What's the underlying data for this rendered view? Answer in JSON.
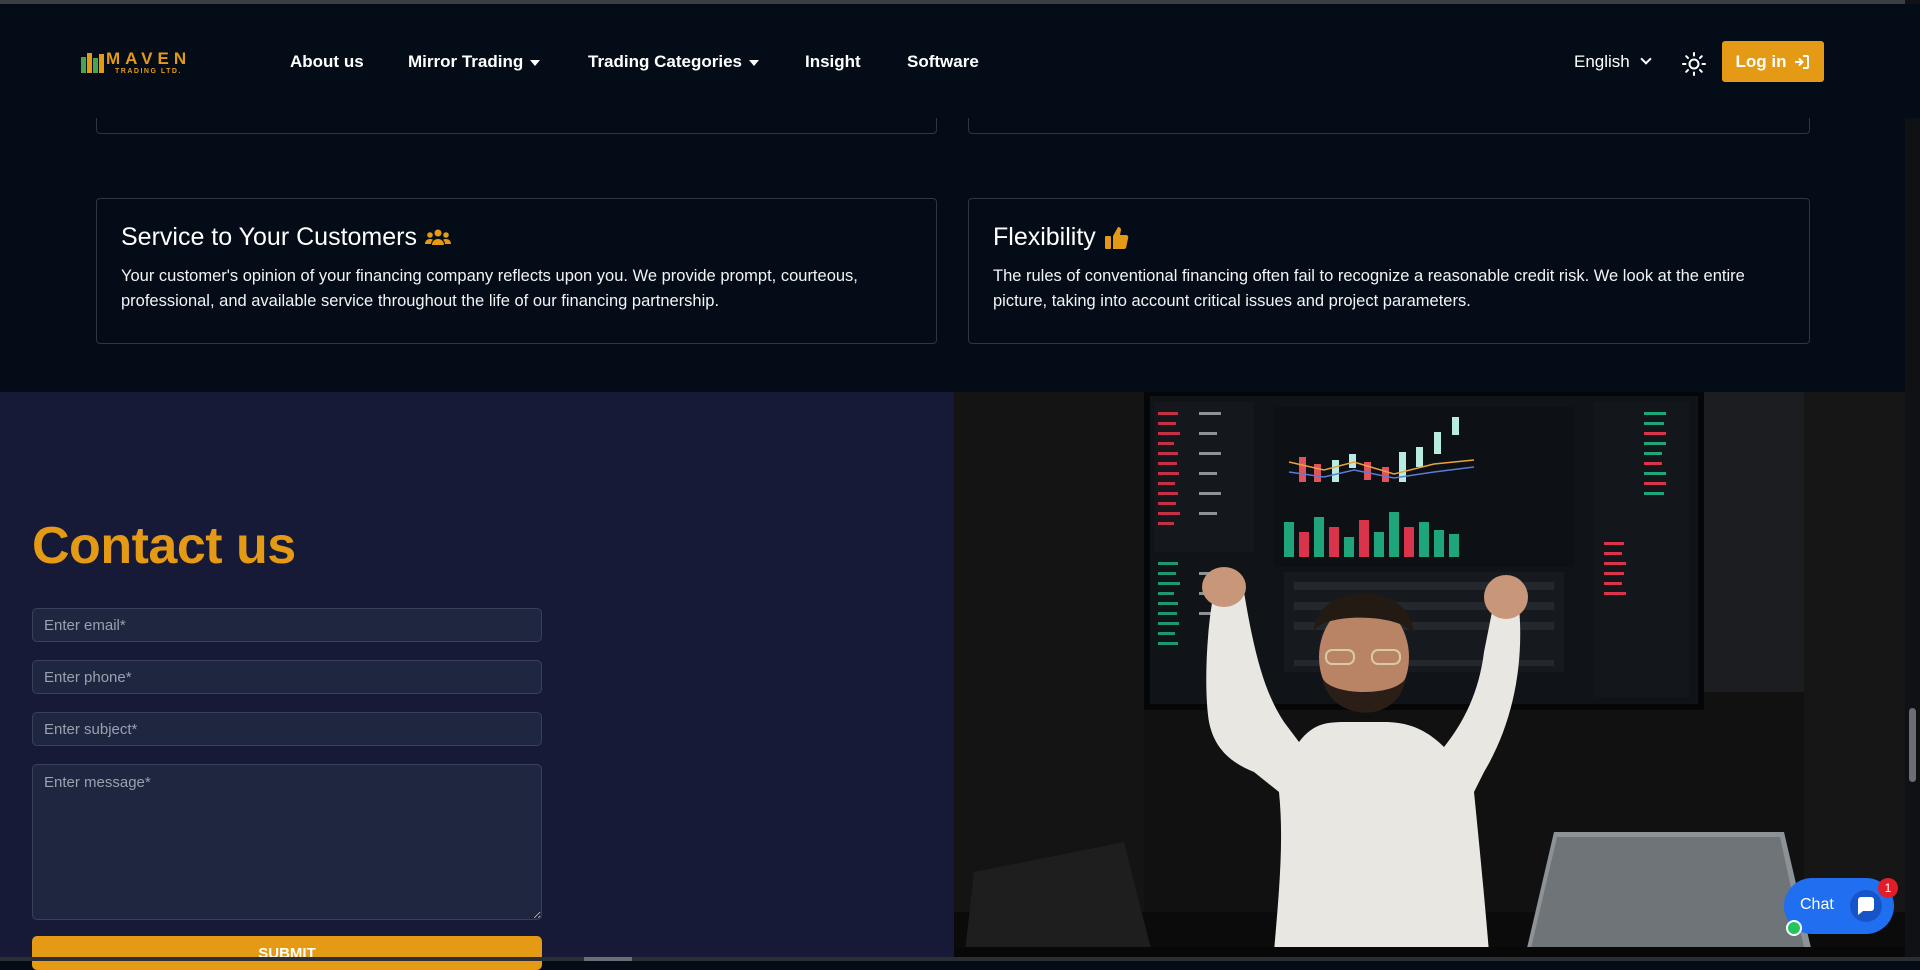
{
  "brand": {
    "name": "MAVEN",
    "tagline": "TRADING LTD.",
    "accent_color": "#e49a14"
  },
  "nav": {
    "items": [
      {
        "label": "About us",
        "has_dropdown": false
      },
      {
        "label": "Mirror Trading",
        "has_dropdown": true
      },
      {
        "label": "Trading Categories",
        "has_dropdown": true
      },
      {
        "label": "Insight",
        "has_dropdown": false
      },
      {
        "label": "Software",
        "has_dropdown": false
      }
    ],
    "language": "English",
    "theme_icon": "sun-icon",
    "login_label": "Log in",
    "login_icon": "sign-in-icon"
  },
  "features": [
    {
      "title": "Service to Your Customers",
      "icon": "users-icon",
      "text": "Your customer's opinion of your financing company reflects upon you. We provide prompt, courteous, professional, and available service throughout the life of our financing partnership."
    },
    {
      "title": "Flexibility",
      "icon": "thumbs-up-icon",
      "text": "The rules of conventional financing often fail to recognize a reasonable credit risk. We look at the entire picture, taking into account critical issues and project parameters."
    }
  ],
  "contact": {
    "title": "Contact us",
    "email_placeholder": "Enter email*",
    "phone_placeholder": "Enter phone*",
    "subject_placeholder": "Enter subject*",
    "message_placeholder": "Enter message*",
    "submit_label": "SUBMIT",
    "background_color": "#161a36"
  },
  "chat": {
    "label": "Chat",
    "badge_count": "1",
    "button_color": "#1f6ff0"
  },
  "colors": {
    "page_background": "#030c17"
  }
}
